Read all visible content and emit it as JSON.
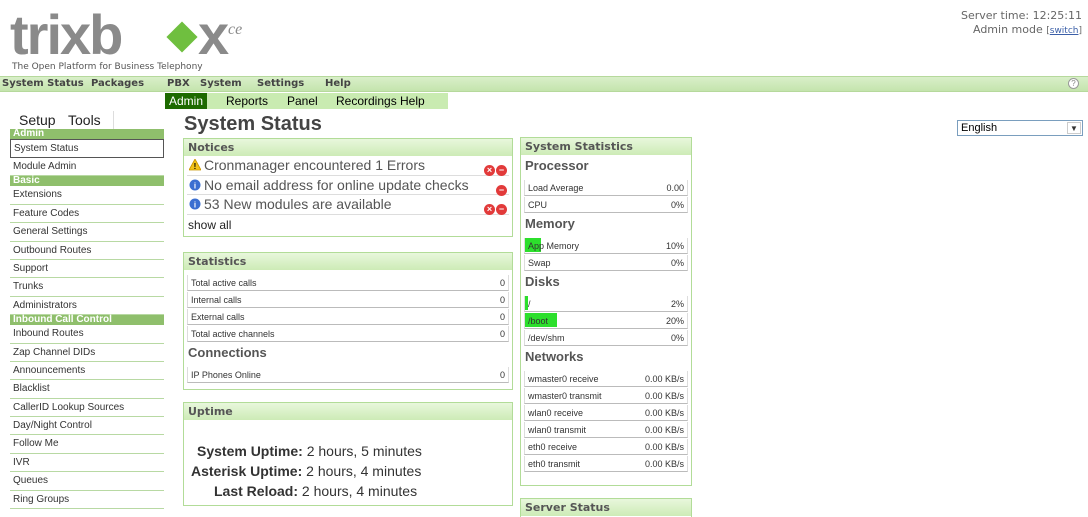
{
  "header": {
    "logo_text": "trixbox",
    "logo_suffix": "ce",
    "tagline": "The Open Platform for Business Telephony",
    "server_time": "Server time: 12:25:11",
    "admin_mode": "Admin mode",
    "switch_label": "switch"
  },
  "topnav": [
    "System Status",
    "Packages",
    "PBX",
    "System",
    "Settings",
    "Help"
  ],
  "topnav_help": "?",
  "subnav": [
    "Admin",
    "Reports",
    "Panel",
    "Recordings",
    "Help"
  ],
  "sidebar": {
    "tabs": [
      "Setup",
      "Tools"
    ],
    "items": [
      {
        "label": "Admin",
        "type": "section"
      },
      {
        "label": "System Status",
        "type": "selected"
      },
      {
        "label": "Module Admin",
        "type": "item"
      },
      {
        "label": "Basic",
        "type": "section"
      },
      {
        "label": "Extensions",
        "type": "item"
      },
      {
        "label": "Feature Codes",
        "type": "item"
      },
      {
        "label": "General Settings",
        "type": "item"
      },
      {
        "label": "Outbound Routes",
        "type": "item"
      },
      {
        "label": "Support",
        "type": "item"
      },
      {
        "label": "Trunks",
        "type": "item"
      },
      {
        "label": "Administrators",
        "type": "item"
      },
      {
        "label": "Inbound Call Control",
        "type": "section"
      },
      {
        "label": "Inbound Routes",
        "type": "item"
      },
      {
        "label": "Zap Channel DIDs",
        "type": "item"
      },
      {
        "label": "Announcements",
        "type": "item"
      },
      {
        "label": "Blacklist",
        "type": "item"
      },
      {
        "label": "CallerID Lookup Sources",
        "type": "item"
      },
      {
        "label": "Day/Night Control",
        "type": "item"
      },
      {
        "label": "Follow Me",
        "type": "item"
      },
      {
        "label": "IVR",
        "type": "item"
      },
      {
        "label": "Queues",
        "type": "item"
      },
      {
        "label": "Ring Groups",
        "type": "item"
      }
    ]
  },
  "page_title": "System Status",
  "notices": {
    "title": "Notices",
    "items": [
      {
        "text": "Cronmanager encountered 1 Errors",
        "icon": "warning-icon",
        "buttons": 2
      },
      {
        "text": "No email address for online update checks",
        "icon": "info-icon",
        "buttons": 1
      },
      {
        "text": "53 New modules are available",
        "icon": "info-icon",
        "buttons": 2
      }
    ],
    "show_all": "show all"
  },
  "statistics": {
    "title": "Statistics",
    "rows": [
      {
        "label": "Total active calls",
        "value": "0"
      },
      {
        "label": "Internal calls",
        "value": "0"
      },
      {
        "label": "External calls",
        "value": "0"
      },
      {
        "label": "Total active channels",
        "value": "0"
      }
    ],
    "connections_title": "Connections",
    "connections": [
      {
        "label": "IP Phones Online",
        "value": "0"
      }
    ]
  },
  "uptime": {
    "title": "Uptime",
    "rows": [
      {
        "label": "System Uptime:",
        "value": "2 hours, 5 minutes"
      },
      {
        "label": "Asterisk Uptime:",
        "value": "2 hours, 4 minutes"
      },
      {
        "label": "Last Reload:",
        "value": "2 hours, 4 minutes"
      }
    ]
  },
  "system_statistics": {
    "title": "System Statistics",
    "processor_title": "Processor",
    "processor": [
      {
        "label": "Load Average",
        "value": "0.00"
      },
      {
        "label": "CPU",
        "value": "0%"
      }
    ],
    "memory_title": "Memory",
    "memory": [
      {
        "label": "App Memory",
        "value": "10%",
        "fill": 0.1
      },
      {
        "label": "Swap",
        "value": "0%",
        "fill": 0
      }
    ],
    "disks_title": "Disks",
    "disks": [
      {
        "label": "/",
        "value": "2%",
        "fill": 0.02
      },
      {
        "label": "/boot",
        "value": "20%",
        "fill": 0.2
      },
      {
        "label": "/dev/shm",
        "value": "0%",
        "fill": 0
      }
    ],
    "networks_title": "Networks",
    "networks": [
      {
        "label": "wmaster0 receive",
        "value": "0.00 KB/s"
      },
      {
        "label": "wmaster0 transmit",
        "value": "0.00 KB/s"
      },
      {
        "label": "wlan0 receive",
        "value": "0.00 KB/s"
      },
      {
        "label": "wlan0 transmit",
        "value": "0.00 KB/s"
      },
      {
        "label": "eth0 receive",
        "value": "0.00 KB/s"
      },
      {
        "label": "eth0 transmit",
        "value": "0.00 KB/s"
      }
    ]
  },
  "server_status": {
    "title": "Server Status"
  },
  "language": {
    "selected": "English"
  },
  "colors": {
    "brand_green": "#8fbf6c",
    "active_tab": "#1d6a00",
    "bar_fill": "#2cdf2c",
    "logo_gray": "#8a8a8a"
  }
}
